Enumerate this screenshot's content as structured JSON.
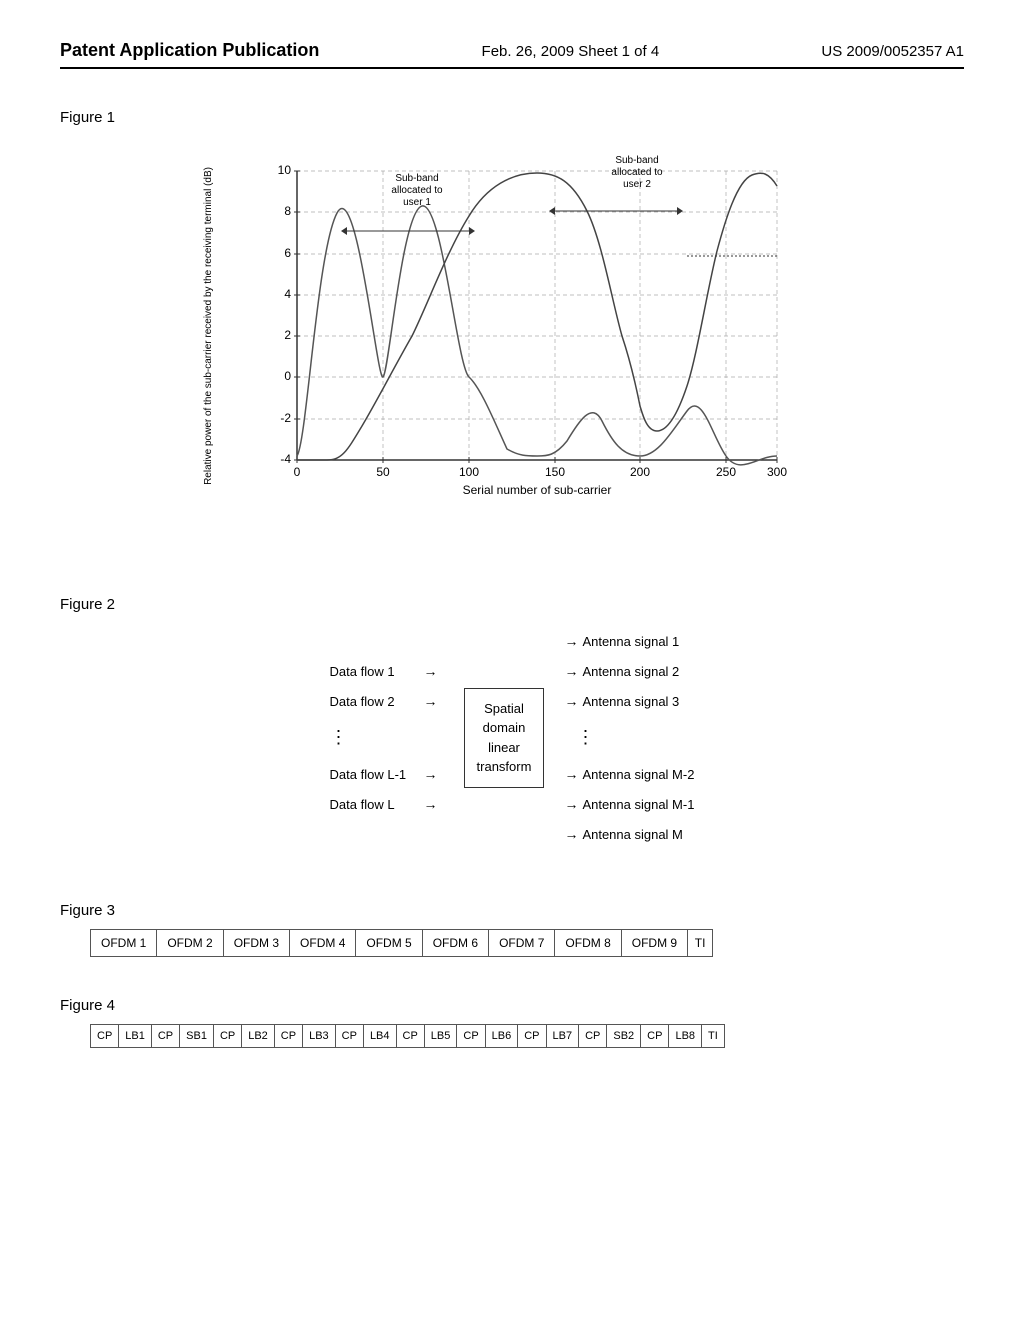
{
  "header": {
    "left": "Patent Application Publication",
    "center": "Feb. 26, 2009   Sheet 1 of 4",
    "right": "US 2009/0052357 A1"
  },
  "figure1": {
    "label": "Figure 1",
    "y_axis_label": "Relative power of the sub-carrier received by the receiving terminal (dB)",
    "x_axis_label": "Serial number of sub-carrier",
    "y_ticks": [
      "10",
      "8",
      "6",
      "4",
      "2",
      "0",
      "-2",
      "-4"
    ],
    "x_ticks": [
      "0",
      "50",
      "100",
      "150",
      "200",
      "250",
      "300"
    ],
    "annotation1": "Sub-band\nallocated to\nuser 2",
    "annotation2": "Sub-band\nallocated to\nuser 1"
  },
  "figure2": {
    "label": "Figure 2",
    "inputs": [
      "Data flow 1",
      "Data flow 2",
      "Data flow L-1",
      "Data flow L"
    ],
    "box": "Spatial\ndomain\nlinear\ntransform",
    "outputs": [
      "Antenna signal 1",
      "Antenna signal 2",
      "Antenna signal 3",
      "Antenna signal M-2",
      "Antenna signal M-1",
      "Antenna signal M"
    ]
  },
  "figure3": {
    "label": "Figure 3",
    "cells": [
      "OFDM 1",
      "OFDM 2",
      "OFDM 3",
      "OFDM 4",
      "OFDM 5",
      "OFDM 6",
      "OFDM 7",
      "OFDM 8",
      "OFDM 9",
      "TI"
    ]
  },
  "figure4": {
    "label": "Figure 4",
    "cells": [
      "CP",
      "LB1",
      "CP",
      "SB1",
      "CP",
      "LB2",
      "CP",
      "LB3",
      "CP",
      "LB4",
      "CP",
      "LB5",
      "CP",
      "LB6",
      "CP",
      "LB7",
      "CP",
      "SB2",
      "CP",
      "LB8",
      "TI"
    ]
  }
}
